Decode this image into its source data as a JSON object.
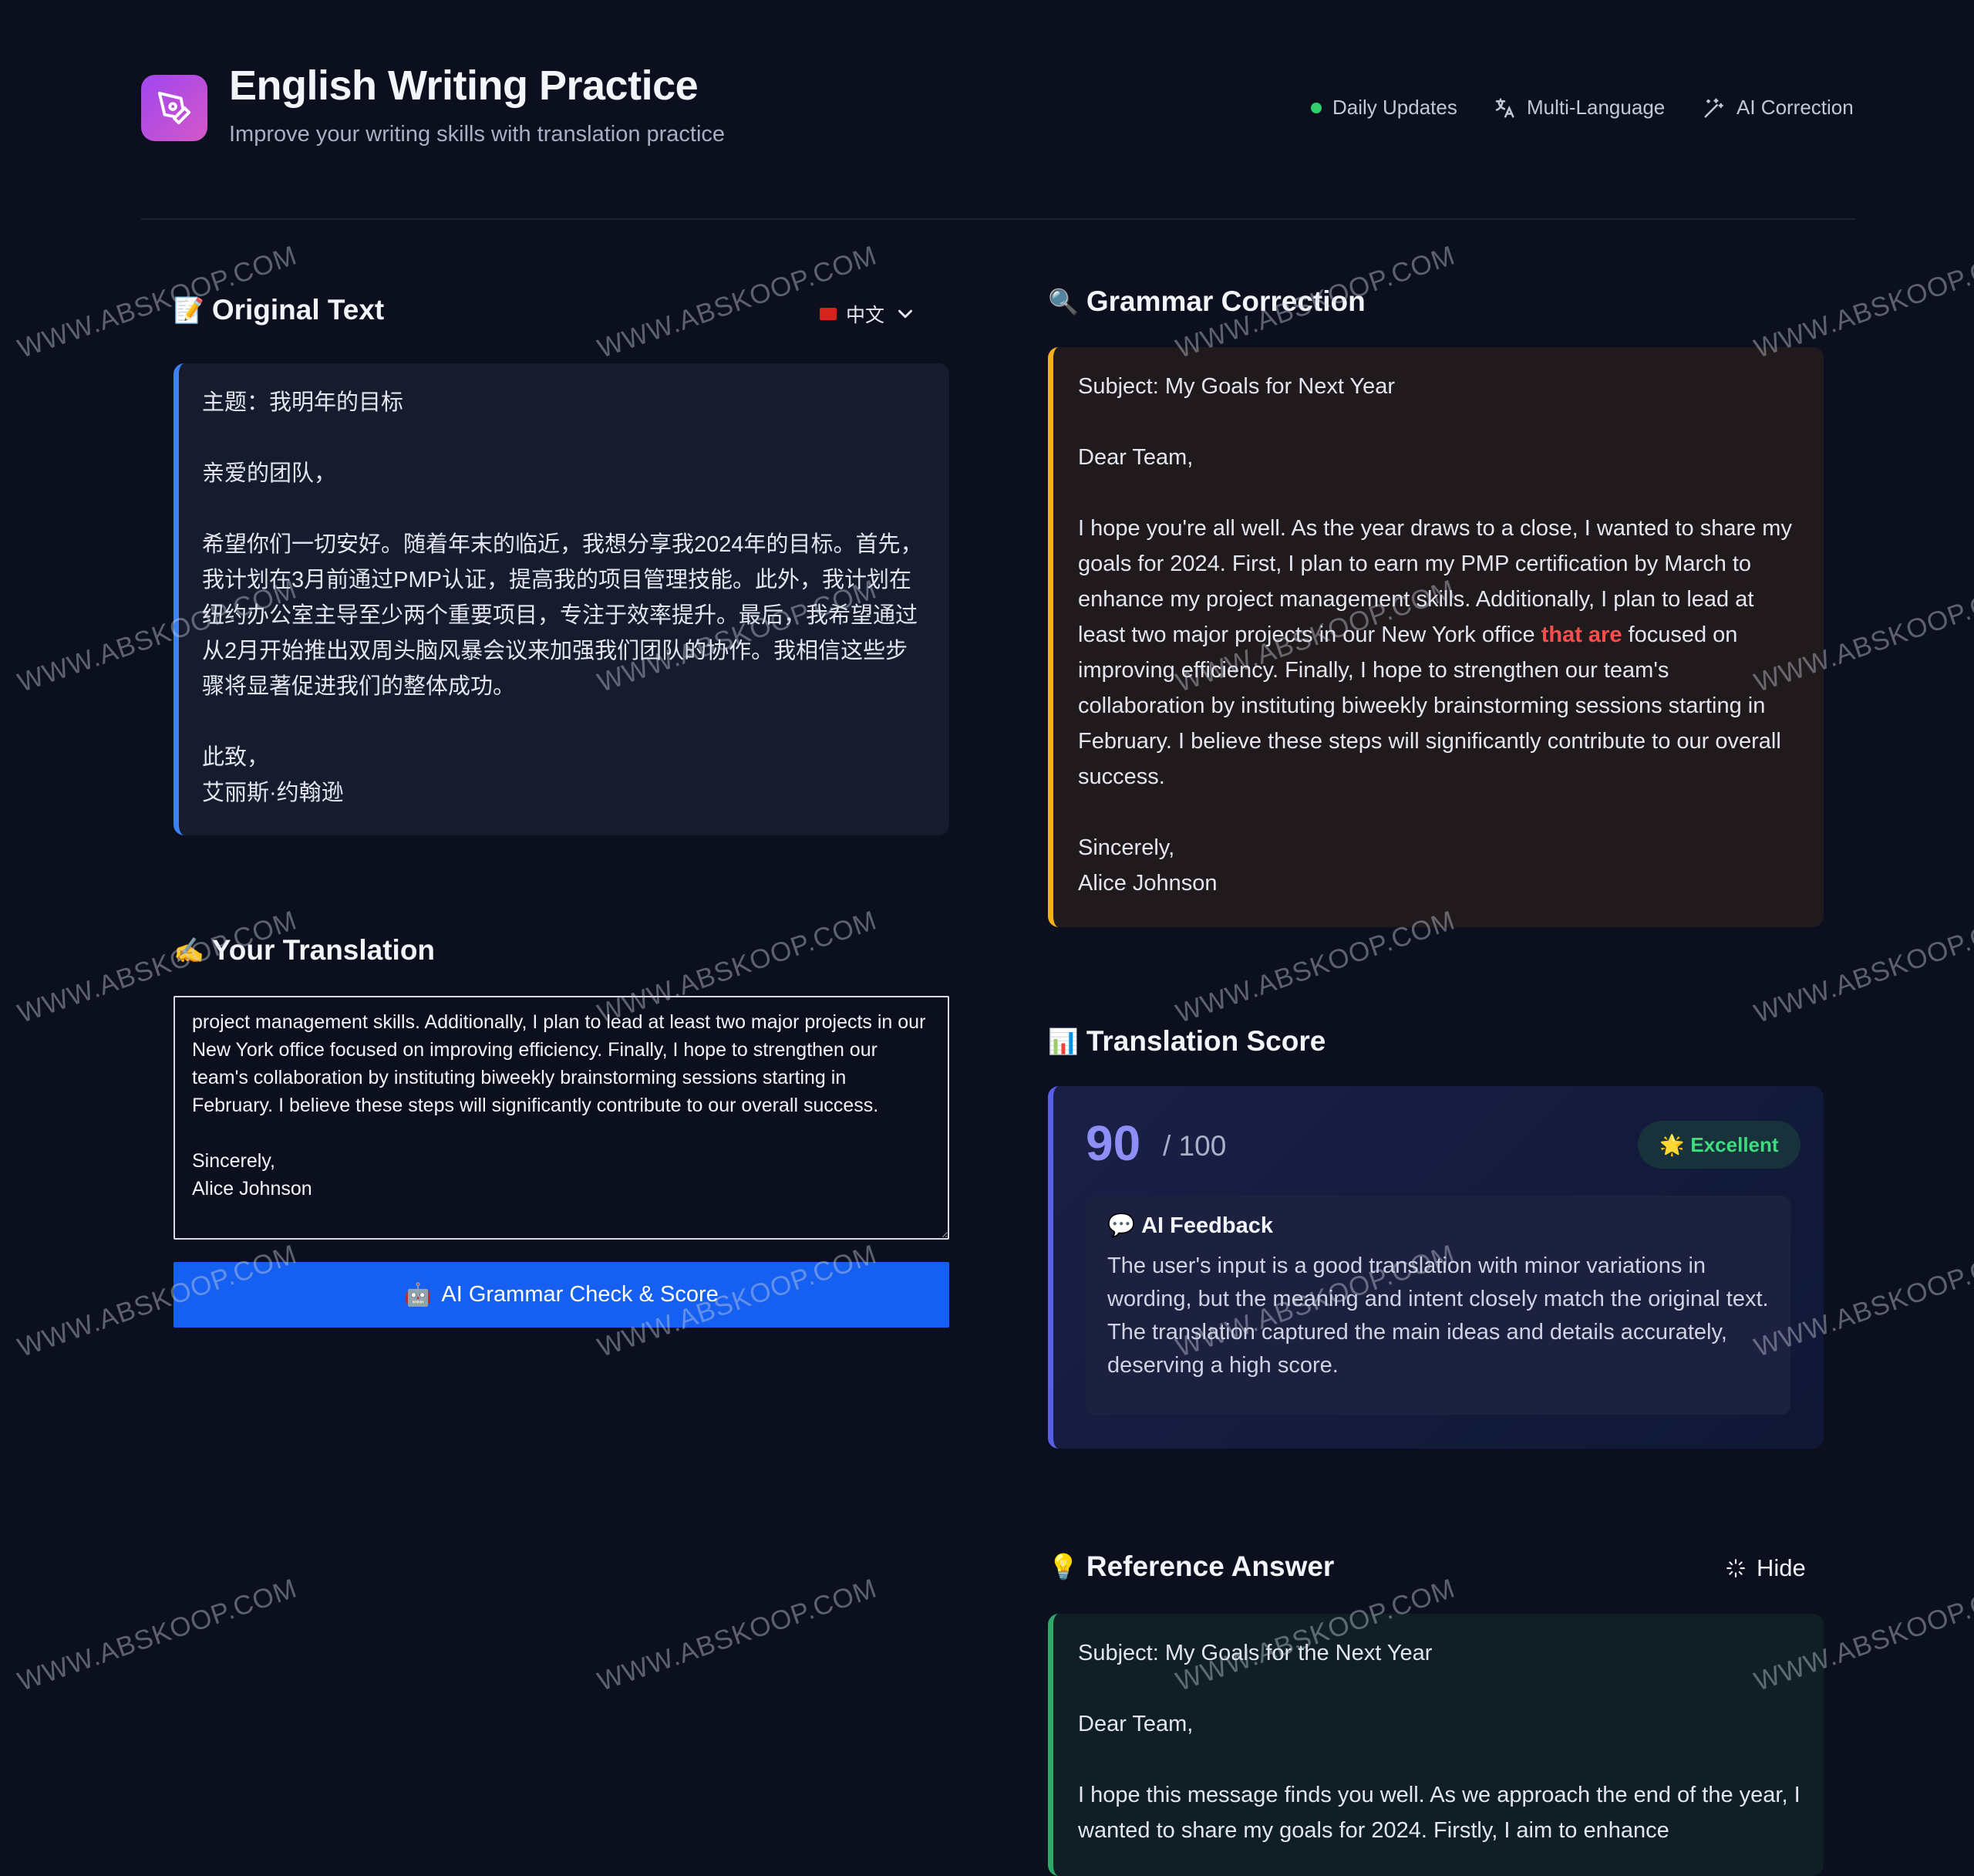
{
  "header": {
    "title": "English Writing Practice",
    "subtitle": "Improve your writing skills with translation practice",
    "features": [
      "Daily Updates",
      "Multi-Language",
      "AI Correction"
    ]
  },
  "original": {
    "title": "Original Text",
    "title_emoji": "📝",
    "language": "中文",
    "text": "主题：我明年的目标\n\n亲爱的团队，\n\n希望你们一切安好。随着年末的临近，我想分享我2024年的目标。首先，我计划在3月前通过PMP认证，提高我的项目管理技能。此外，我计划在纽约办公室主导至少两个重要项目，专注于效率提升。最后，我希望通过从2月开始推出双周头脑风暴会议来加强我们团队的协作。我相信这些步骤将显著促进我们的整体成功。\n\n此致，\n艾丽斯·约翰逊"
  },
  "translation": {
    "title": "Your Translation",
    "title_emoji": "✍️",
    "value": "project management skills. Additionally, I plan to lead at least two major projects in our New York office focused on improving efficiency. Finally, I hope to strengthen our team's collaboration by instituting biweekly brainstorming sessions starting in February. I believe these steps will significantly contribute to our overall success.\n\nSincerely,\nAlice Johnson",
    "button_label": "AI Grammar Check & Score",
    "button_emoji": "🤖"
  },
  "grammar": {
    "title": "Grammar Correction",
    "title_emoji": "🔍",
    "before": "Subject: My Goals for Next Year\n\nDear Team,\n\nI hope you're all well. As the year draws to a close, I wanted to share my goals for 2024. First, I plan to earn my PMP certification by March to enhance my project management skills. Additionally, I plan to lead at least two major projects in our New York office ",
    "highlight": "that are",
    "after": " focused on improving efficiency. Finally, I hope to strengthen our team's collaboration by instituting biweekly brainstorming sessions starting in February. I believe these steps will significantly contribute to our overall success.\n\nSincerely,\nAlice Johnson"
  },
  "score": {
    "title": "Translation Score",
    "title_emoji": "📊",
    "value": "90",
    "max": "/ 100",
    "badge": "Excellent",
    "badge_emoji": "🌟",
    "feedback_title": "AI Feedback",
    "feedback_emoji": "💬",
    "feedback_text": "The user's input is a good translation with minor variations in wording, but the meaning and intent closely match the original text. The translation captured the main ideas and details accurately, deserving a high score."
  },
  "reference": {
    "title": "Reference Answer",
    "title_emoji": "💡",
    "hide_label": "Hide",
    "text": "Subject: My Goals for the Next Year\n\nDear Team,\n\nI hope this message finds you well. As we approach the end of the year, I wanted to share my goals for 2024. Firstly, I aim to enhance"
  },
  "watermark": "WWW.ABSKOOP.COM",
  "colors": {
    "background": "#0c0f1e",
    "original_accent": "#3b82f6",
    "grammar_accent": "#f2b01e",
    "reference_accent": "#2fa86a",
    "score_accent": "#5b5fe6",
    "highlight": "#ff4d4d",
    "button": "#1560f0"
  }
}
